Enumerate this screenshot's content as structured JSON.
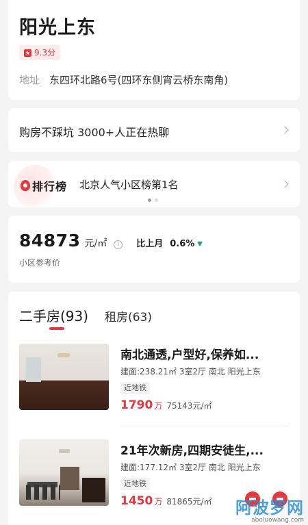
{
  "header": {
    "title": "阳光上东",
    "rating": "9.3分",
    "address_label": "地址",
    "address_value": "东四环北路6号(四环东侧宵云桥东南角)"
  },
  "chat": {
    "text": "购房不踩坑 3000+人正在热聊"
  },
  "ranking": {
    "logo_text": "排行榜",
    "text": "北京人气小区榜第1名",
    "carousel_pages": 2,
    "carousel_active": 1
  },
  "price": {
    "value": "84873",
    "unit": "元/㎡",
    "compare_label": "比上月",
    "compare_value": "0.6%",
    "compare_direction": "down",
    "caption": "小区参考价"
  },
  "listings_section": {
    "tab_active": "二手房(93)",
    "tab_other": "租房(63)",
    "items": [
      {
        "title": "南北通透,户型好,保养如...",
        "meta": "建面:238.21㎡ 3室2厅 南北 阳光上东",
        "tag": "近地铁",
        "total": "1790",
        "total_unit": "万",
        "unit_price": "75143元/㎡"
      },
      {
        "title": "21年次新房,四期安徒生,...",
        "meta": "建面:177.12㎡ 3室2厅 南北 阳光上东",
        "tag": "近地铁",
        "total": "1450",
        "total_unit": "万",
        "unit_price": "81865元/㎡"
      }
    ]
  },
  "watermark": {
    "main": "阿波罗网",
    "sub": "aboluowang.com"
  },
  "colors": {
    "accent": "#e0393e",
    "down": "#1aa37a",
    "background": "#f4f4f5"
  }
}
